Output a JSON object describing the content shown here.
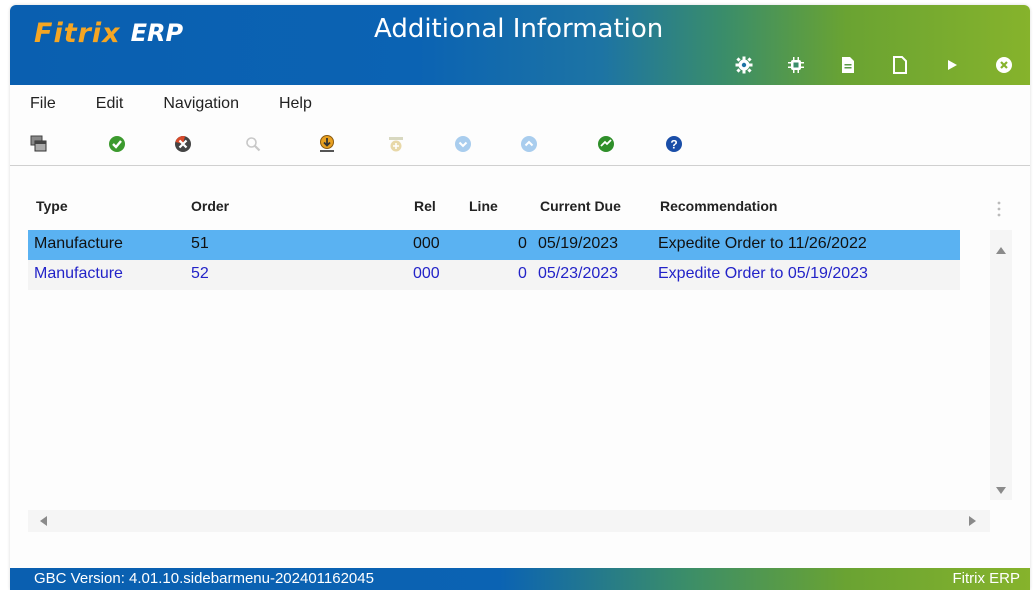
{
  "app": {
    "logo_name": "Fitrix",
    "logo_suffix": "ERP",
    "window_title": "Additional Information"
  },
  "title_icons": [
    "gear-icon",
    "chip-icon",
    "document-filled-icon",
    "document-blank-icon",
    "play-icon",
    "close-circle-icon"
  ],
  "menu": {
    "file": "File",
    "edit": "Edit",
    "navigation": "Navigation",
    "help": "Help"
  },
  "toolbar_icons": [
    "windows-icon",
    "accept-icon",
    "cancel-icon",
    "zoom-icon",
    "download-icon",
    "attach-icon",
    "scroll-down-icon",
    "scroll-up-icon",
    "refresh-icon",
    "help-icon"
  ],
  "table": {
    "columns": {
      "type": "Type",
      "order": "Order",
      "rel": "Rel",
      "line": "Line",
      "current_due": "Current Due",
      "recommendation": "Recommendation"
    },
    "rows": [
      {
        "type": "Manufacture",
        "order": "51",
        "rel": "000",
        "line": "0",
        "current_due": "05/19/2023",
        "recommendation": "Expedite Order to 11/26/2022"
      },
      {
        "type": "Manufacture",
        "order": "52",
        "rel": "000",
        "line": "0",
        "current_due": "05/23/2023",
        "recommendation": "Expedite Order to 05/19/2023"
      }
    ]
  },
  "status": {
    "version": "GBC Version: 4.01.10.sidebarmenu-202401162045",
    "product": "Fitrix ERP"
  },
  "colors": {
    "brand_blue": "#0b63b3",
    "brand_green": "#86b32c",
    "logo_orange": "#f5a623",
    "selected_row": "#5ab2f2",
    "row_text_blue": "#2323c8"
  }
}
